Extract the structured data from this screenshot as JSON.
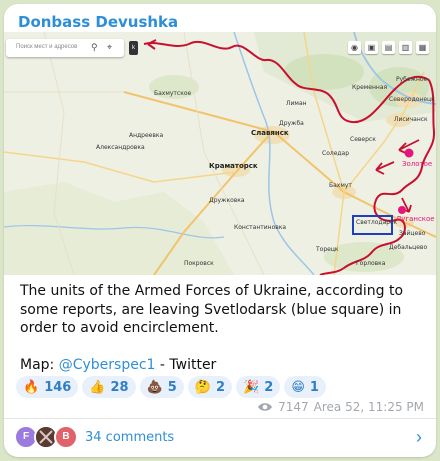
{
  "post": {
    "channel_name": "Donbass Devushka",
    "caption_line1": "The units of the Armed Forces of Ukraine, according to some reports, are leaving Svetlodarsk (blue square) in order to avoid encirclement.",
    "map_prefix": "Map: ",
    "map_link": "@Cyberspec1",
    "map_suffix": " - Twitter"
  },
  "map": {
    "search_placeholder": "Поиск мест и адресов",
    "toggle_label": "k",
    "tools": [
      "◉",
      "▣",
      "▤",
      "▥",
      "▦"
    ],
    "towns": [
      {
        "name": "Бахмутское",
        "cls": "",
        "bind": "0"
      },
      {
        "name": "Славянск",
        "cls": "big",
        "bind": "1"
      },
      {
        "name": "Краматорск",
        "cls": "big",
        "bind": "2"
      },
      {
        "name": "Дружковка",
        "cls": "",
        "bind": "3"
      },
      {
        "name": "Константиновка",
        "cls": "",
        "bind": "4"
      },
      {
        "name": "Покровск",
        "cls": "",
        "bind": "5"
      },
      {
        "name": "Лисичанск",
        "cls": "",
        "bind": "6"
      },
      {
        "name": "Северодонецк",
        "cls": "",
        "bind": "7"
      },
      {
        "name": "Соледар",
        "cls": "",
        "bind": "8"
      },
      {
        "name": "Бахмут",
        "cls": "",
        "bind": "9"
      },
      {
        "name": "Торецк",
        "cls": "",
        "bind": "10"
      },
      {
        "name": "Золотое",
        "cls": "pink",
        "bind": "11"
      },
      {
        "name": "Луганское",
        "cls": "pink",
        "bind": "12"
      },
      {
        "name": "Светлодарск",
        "cls": "",
        "bind": "13"
      },
      {
        "name": "Дебальцево",
        "cls": "",
        "bind": "14"
      },
      {
        "name": "Горловка",
        "cls": "",
        "bind": "15"
      },
      {
        "name": "Кременная",
        "cls": "",
        "bind": "16"
      },
      {
        "name": "Лиман",
        "cls": "",
        "bind": "17"
      },
      {
        "name": "Рубежное",
        "cls": "",
        "bind": "18"
      },
      {
        "name": "Северск",
        "cls": "",
        "bind": "19"
      },
      {
        "name": "Андреевка",
        "cls": "",
        "bind": "20"
      },
      {
        "name": "Александровка",
        "cls": "",
        "bind": "21"
      },
      {
        "name": "Дружба",
        "cls": "",
        "bind": "22"
      },
      {
        "name": "Зайцево",
        "cls": "",
        "bind": "23"
      }
    ]
  },
  "reactions": [
    {
      "emoji": "🔥",
      "count": "146"
    },
    {
      "emoji": "👍",
      "count": "28"
    },
    {
      "emoji": "💩",
      "count": "5"
    },
    {
      "emoji": "🤔",
      "count": "2"
    },
    {
      "emoji": "🎉",
      "count": "2"
    },
    {
      "emoji": "😁",
      "count": "1"
    }
  ],
  "meta": {
    "views": "7147",
    "author_time": "Area 52, 11:25 PM"
  },
  "comments": {
    "label": "34 comments",
    "avatars": [
      "F",
      "",
      "B"
    ]
  },
  "colors": {
    "accent": "#2f8fd6",
    "front_line": "#c8102e",
    "marker": "#e6157c",
    "highlight_box": "#1f3fbf"
  }
}
